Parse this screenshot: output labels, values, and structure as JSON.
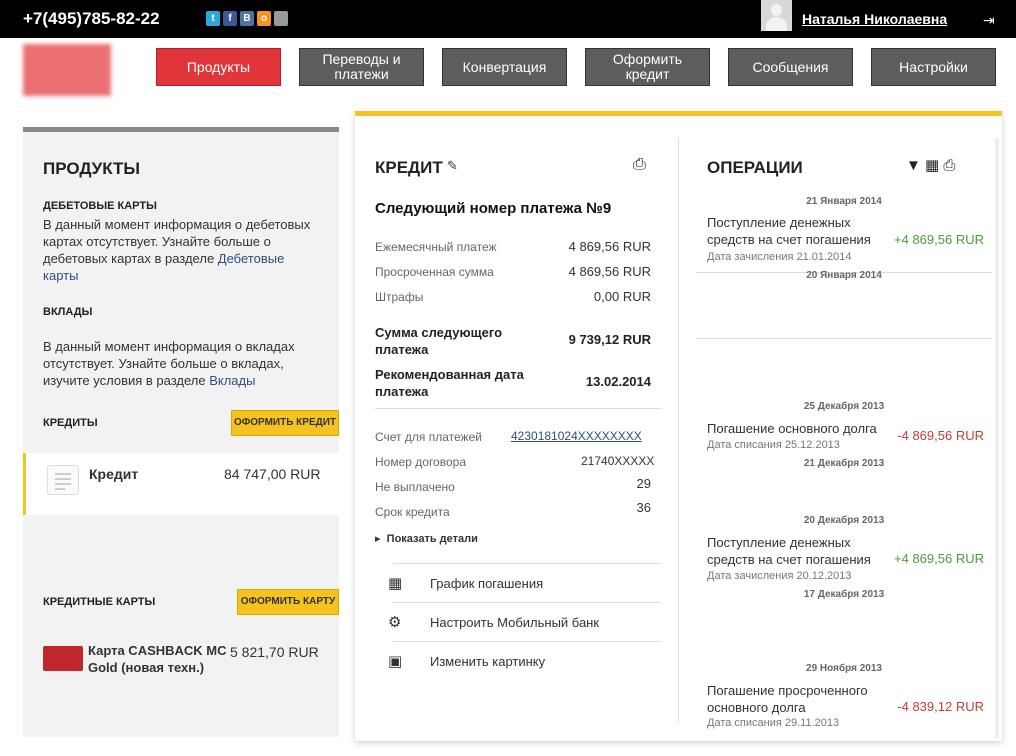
{
  "header": {
    "phone": "+7(495)785-82-22",
    "social": [
      {
        "name": "twitter-icon",
        "glyph": "t",
        "color": "#29a9e1"
      },
      {
        "name": "facebook-icon",
        "glyph": "f",
        "color": "#3b5998"
      },
      {
        "name": "vk-icon",
        "glyph": "В",
        "color": "#4c75a3"
      },
      {
        "name": "odnoklassniki-icon",
        "glyph": "о",
        "color": "#f7931e"
      },
      {
        "name": "apple-icon",
        "glyph": "",
        "color": "#999999"
      }
    ],
    "username": "Наталья Николаевна"
  },
  "nav": [
    {
      "label": "Продукты",
      "active": true
    },
    {
      "label": "Переводы и платежи",
      "active": false
    },
    {
      "label": "Конвертация",
      "active": false
    },
    {
      "label": "Оформить кредит",
      "active": false
    },
    {
      "label": "Сообщения",
      "active": false
    },
    {
      "label": "Настройки",
      "active": false
    }
  ],
  "left": {
    "title": "ПРОДУКТЫ",
    "debit_label": "ДЕБЕТОВЫЕ КАРТЫ",
    "debit_text": "В данный момент информация о дебетовых картах отсутствует. Узнайте больше о дебетовых картах в разделе ",
    "debit_link": "Дебетовые карты",
    "deposits_label": "ВКЛАДЫ",
    "deposits_text": "В данный момент информация о вкладах отсутствует. Узнайте больше о вкладах, изучите условия в разделе ",
    "deposits_link": "Вклады",
    "credits_label": "КРЕДИТЫ",
    "credit_button": "ОФОРМИТЬ КРЕДИТ",
    "credit_item_name": "Кредит",
    "credit_item_amount": "84 747,00 RUR",
    "cards_label": "КРЕДИТНЫЕ КАРТЫ",
    "card_button": "ОФОРМИТЬ КАРТУ",
    "card_name": "Карта CASHBACK MC Gold (новая техн.)",
    "card_amount": "5 821,70 RUR"
  },
  "credit": {
    "title": "КРЕДИТ",
    "next_title": "Следующий номер платежа №9",
    "monthly_label": "Ежемесячный платеж",
    "monthly_value": "4 869,56 RUR",
    "overdue_label": "Просроченная сумма",
    "overdue_value": "4 869,56 RUR",
    "fines_label": "Штрафы",
    "fines_value": "0,00 RUR",
    "next_sum_label": "Сумма следующего платежа",
    "next_sum_value": "9 739,12 RUR",
    "rec_date_label": "Рекомендованная дата платежа",
    "rec_date_value": "13.02.2014",
    "account_label": "Счет для платежей",
    "account_value": "4230181024XXXXXXXX",
    "contract_label": "Номер договора",
    "contract_value": "21740XXXXX",
    "unpaid_label": "Не выплачено",
    "unpaid_value": "29",
    "term_label": "Срок кредита",
    "term_value": "36",
    "details": "Показать детали",
    "actions": [
      {
        "name": "schedule",
        "label": "График погашения",
        "icon": "calendar-icon"
      },
      {
        "name": "mobile-bank",
        "label": "Настроить Мобильный банк",
        "icon": "mobile-settings-icon"
      },
      {
        "name": "change-picture",
        "label": "Изменить картинку",
        "icon": "image-icon"
      }
    ]
  },
  "operations": {
    "title": "ОПЕРАЦИИ",
    "groups": [
      {
        "date": "21 Января 2014",
        "desc": "Поступление денежных средств на счет погашения",
        "sub": "Дата зачисления 21.01.2014",
        "amount": "+4 869,56 RUR",
        "positive": true
      },
      {
        "date": "20 Января 2014",
        "desc": "",
        "sub": "",
        "amount": "",
        "positive": true
      },
      {
        "date": "25 Декабря 2013",
        "desc": "Погашение основного долга",
        "sub": "Дата списания 25.12.2013",
        "amount": "-4 869,56 RUR",
        "positive": false
      },
      {
        "date": "21 Декабря 2013",
        "desc": "",
        "sub": "",
        "amount": "",
        "positive": true
      },
      {
        "date": "20 Декабря 2013",
        "desc": "Поступление денежных средств на счет погашения",
        "sub": "Дата зачисления 20.12.2013",
        "amount": "+4 869,56 RUR",
        "positive": true
      },
      {
        "date": "17 Декабря 2013",
        "desc": "",
        "sub": "",
        "amount": "",
        "positive": true
      },
      {
        "date": "29 Ноября 2013",
        "desc": "Погашение просроченного основного долга",
        "sub": "Дата списания 29.11.2013",
        "amount": "-4 839,12 RUR",
        "positive": false
      }
    ]
  }
}
